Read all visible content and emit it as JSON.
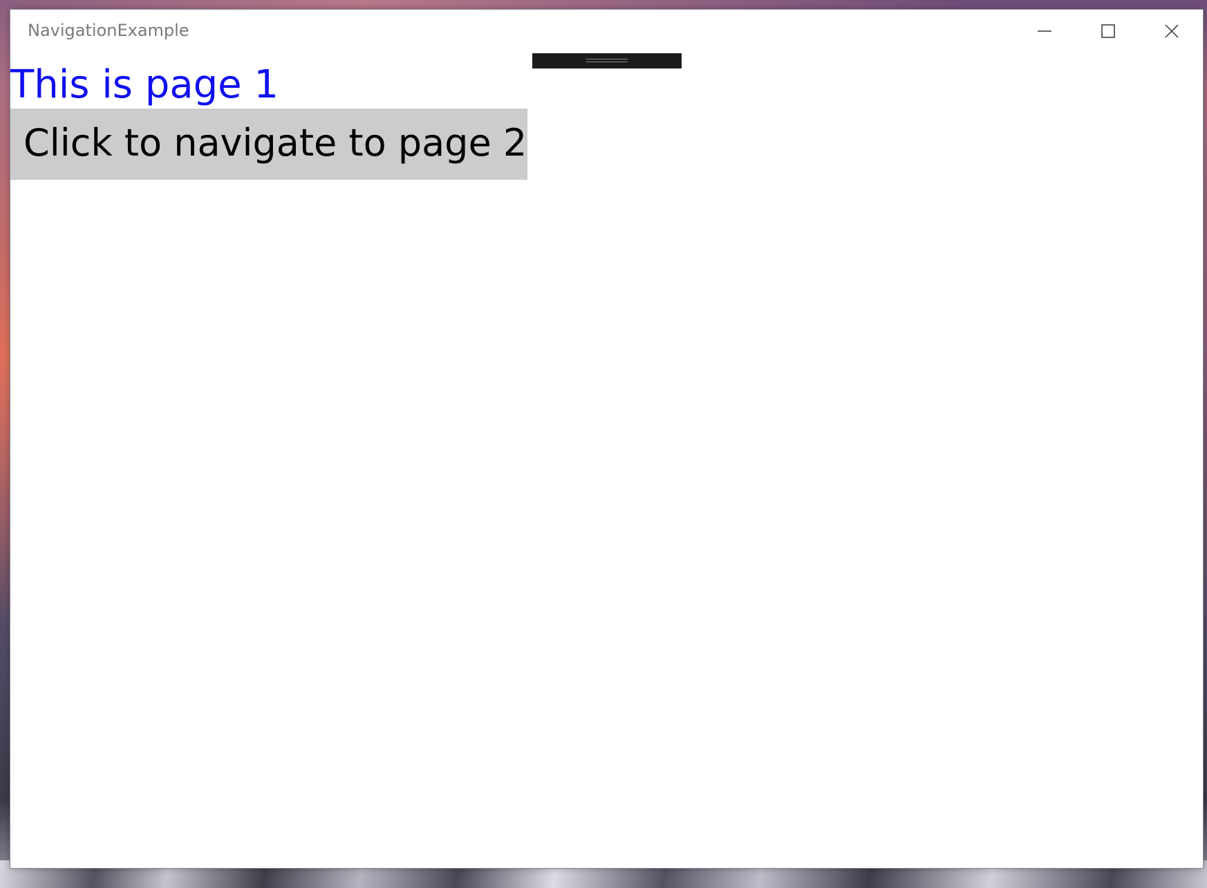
{
  "window": {
    "title": "NavigationExample",
    "controls": {
      "minimize_icon": "minimize-icon",
      "maximize_icon": "maximize-icon",
      "close_icon": "close-icon"
    }
  },
  "page": {
    "heading": "This is page 1",
    "heading_color": "#1010ee",
    "navigate_button_label": "Click to navigate to page 2",
    "navigate_button_color": "#cccccc"
  }
}
